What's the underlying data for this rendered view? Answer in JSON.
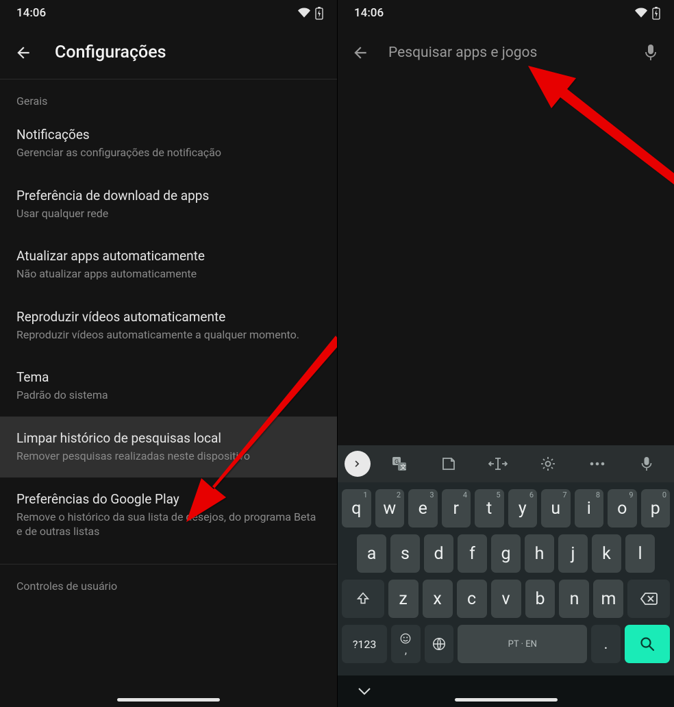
{
  "left": {
    "status": {
      "time": "14:06"
    },
    "header": {
      "title": "Configurações"
    },
    "section_label": "Gerais",
    "items": [
      {
        "title": "Notificações",
        "sub": "Gerenciar as configurações de notificação"
      },
      {
        "title": "Preferência de download de apps",
        "sub": "Usar qualquer rede"
      },
      {
        "title": "Atualizar apps automaticamente",
        "sub": "Não atualizar apps automaticamente"
      },
      {
        "title": "Reproduzir vídeos automaticamente",
        "sub": "Reproduzir vídeos automaticamente a qualquer momento."
      },
      {
        "title": "Tema",
        "sub": "Padrão do sistema"
      },
      {
        "title": "Limpar histórico de pesquisas local",
        "sub": "Remover pesquisas realizadas neste dispositivo"
      },
      {
        "title": "Preferências do Google Play",
        "sub": "Remove o histórico da sua lista de desejos, do programa Beta e de outras listas"
      }
    ],
    "section_label2": "Controles de usuário"
  },
  "right": {
    "status": {
      "time": "14:06"
    },
    "search": {
      "placeholder": "Pesquisar apps e jogos"
    },
    "keyboard": {
      "rows": {
        "r1": [
          "q",
          "w",
          "e",
          "r",
          "t",
          "y",
          "u",
          "i",
          "o",
          "p"
        ],
        "r1hints": [
          "1",
          "2",
          "3",
          "4",
          "5",
          "6",
          "7",
          "8",
          "9",
          "0"
        ],
        "r2": [
          "a",
          "s",
          "d",
          "f",
          "g",
          "h",
          "j",
          "k",
          "l"
        ],
        "r3": [
          "z",
          "x",
          "c",
          "v",
          "b",
          "n",
          "m"
        ]
      },
      "numkey": "?123",
      "emoji": "☺",
      "spacebar": "PT · EN",
      "period": "."
    }
  }
}
